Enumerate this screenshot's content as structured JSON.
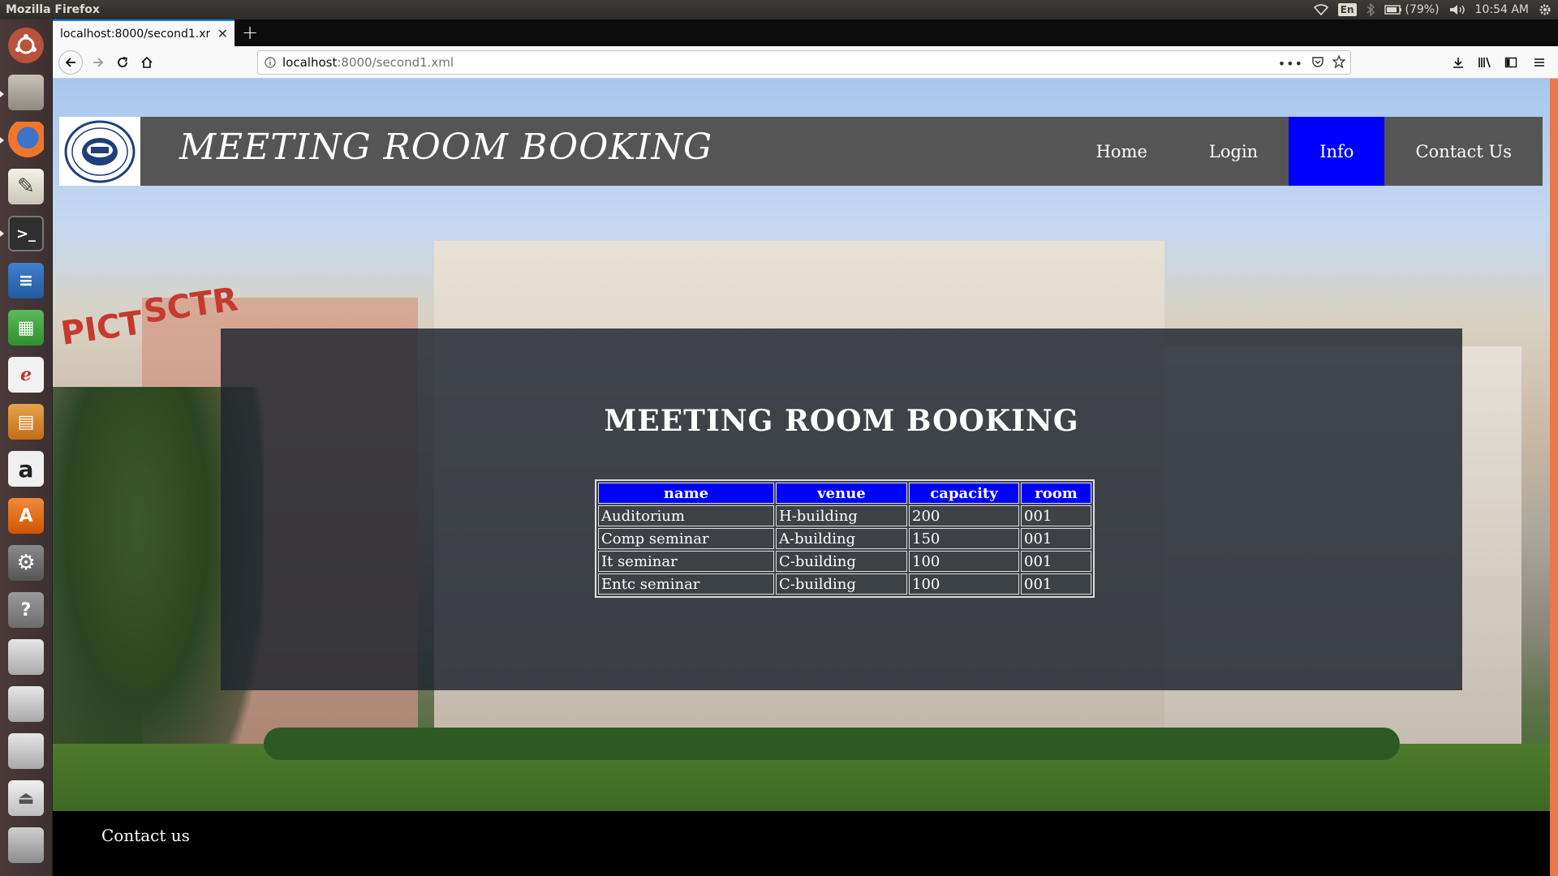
{
  "os": {
    "window_title": "Mozilla Firefox",
    "keyboard": "En",
    "battery": "(79%)",
    "clock": "10:54 AM"
  },
  "browser": {
    "tab_title": "localhost:8000/second1.xml",
    "url_host": "localhost",
    "url_rest": ":8000/second1.xml"
  },
  "page": {
    "site_title": "MEETING ROOM BOOKING",
    "nav": [
      "Home",
      "Login",
      "Info",
      "Contact Us"
    ],
    "active_nav": "Info",
    "panel_title": "MEETING ROOM BOOKING",
    "table": {
      "headers": [
        "name",
        "venue",
        "capacity",
        "room"
      ],
      "rows": [
        [
          "Auditorium",
          "H-building",
          "200",
          "001"
        ],
        [
          "Comp seminar",
          "A-building",
          "150",
          "001"
        ],
        [
          "It seminar",
          "C-building",
          "100",
          "001"
        ],
        [
          "Entc seminar",
          "C-building",
          "100",
          "001"
        ]
      ]
    },
    "footer": "Contact us",
    "background_signs": [
      "PICT",
      "SCTR"
    ]
  },
  "colors": {
    "accent": "#0000ff",
    "header_bg": "#555555",
    "footer_bg": "#000000",
    "firefox_tab_accent": "#0a84ff"
  }
}
